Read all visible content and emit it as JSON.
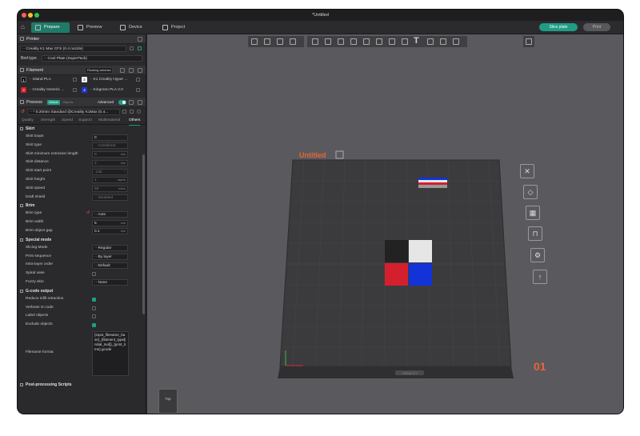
{
  "window": {
    "title": "*Untitled"
  },
  "topbar": {
    "tabs": [
      {
        "label": "Prepare",
        "active": true
      },
      {
        "label": "Preview",
        "active": false
      },
      {
        "label": "Device",
        "active": false
      },
      {
        "label": "Project",
        "active": false
      }
    ],
    "slice_label": "Slice plate",
    "print_label": "Print"
  },
  "printer": {
    "header": "Printer",
    "name": "·· Creality K1 Max CFS (0.4 nozzle)",
    "bed_type_label": "Bed type",
    "bed_type_value": "·· Cool Plate (SuperTack)"
  },
  "filament": {
    "header": "Filament",
    "flushing_label": "Flushing volumes",
    "items": [
      {
        "num": "1",
        "name": "·· Inland PLA",
        "color": "#111111"
      },
      {
        "num": "2",
        "name": "·· K1 Creality Hyper ...",
        "color": "#f2f2f2"
      },
      {
        "num": "3",
        "name": "·· Creality Generic ...",
        "color": "#d4202c"
      },
      {
        "num": "4",
        "name": "·· Kingroon PLA 2.0",
        "color": "#1e33d6"
      }
    ]
  },
  "process": {
    "header": "Process",
    "global_label": "Global",
    "objects_label": "Objects",
    "advanced_label": "Advanced",
    "preset": "·· * 0.20mm Standard @Creality K1Max (0.4...",
    "tabs": [
      {
        "label": "Quality",
        "active": false
      },
      {
        "label": "Strength",
        "active": false
      },
      {
        "label": "Speed",
        "active": false
      },
      {
        "label": "Support",
        "active": false
      },
      {
        "label": "Multimaterial",
        "active": false
      },
      {
        "label": "Others",
        "active": true
      }
    ]
  },
  "skirt": {
    "title": "Skirt",
    "loops": {
      "label": "Skirt loops",
      "value": "0"
    },
    "type": {
      "label": "Skirt type",
      "value": "·· Combined"
    },
    "min_extrusion": {
      "label": "Skirt minimum extrusion length",
      "value": "0",
      "unit": "mm"
    },
    "distance": {
      "label": "Skirt distance",
      "value": "2",
      "unit": "mm"
    },
    "start_point": {
      "label": "Skirt start point",
      "value": "-135",
      "unit": "°"
    },
    "height": {
      "label": "Skirt height",
      "value": "1",
      "unit": "layers"
    },
    "speed": {
      "label": "Skirt speed",
      "value": "50",
      "unit": "mm/s"
    },
    "draft_shield": {
      "label": "Draft shield",
      "value": "·· Disabled"
    }
  },
  "brim": {
    "title": "Brim",
    "type": {
      "label": "Brim type",
      "value": "·· Auto"
    },
    "width": {
      "label": "Brim width",
      "value": "5",
      "unit": "mm"
    },
    "gap": {
      "label": "Brim-object gap",
      "value": "0.1",
      "unit": "mm"
    }
  },
  "special": {
    "title": "Special mode",
    "slicing": {
      "label": "Slicing Mode",
      "value": "·· Regular"
    },
    "sequence": {
      "label": "Print sequence",
      "value": "·· By layer"
    },
    "intra": {
      "label": "Intra-layer order",
      "value": "·· Default"
    },
    "spiral": {
      "label": "Spiral vase"
    },
    "fuzzy": {
      "label": "Fuzzy skin",
      "value": "·· None"
    }
  },
  "gcode": {
    "title": "G-code output",
    "reduce": {
      "label": "Reduce infill retraction",
      "checked": true
    },
    "verbose": {
      "label": "Verbose G-code",
      "checked": false
    },
    "label_objects": {
      "label": "Label objects",
      "checked": false
    },
    "exclude": {
      "label": "Exclude objects",
      "checked": true
    },
    "filename": {
      "label": "Filename format",
      "value": "{input_filename_base}_{filament_type[initial_tool]}_{print_time}.gcode"
    }
  },
  "post_title": "Post-processing Scripts",
  "plate": {
    "title": "Untitled",
    "number": "01",
    "brand": "CREALITY",
    "thumb_label": "Top",
    "title_color": "#e8643a",
    "number_color": "#e8643a",
    "tiles": [
      "#222222",
      "#e6e6e6",
      "#d4202c",
      "#1233d8"
    ]
  }
}
